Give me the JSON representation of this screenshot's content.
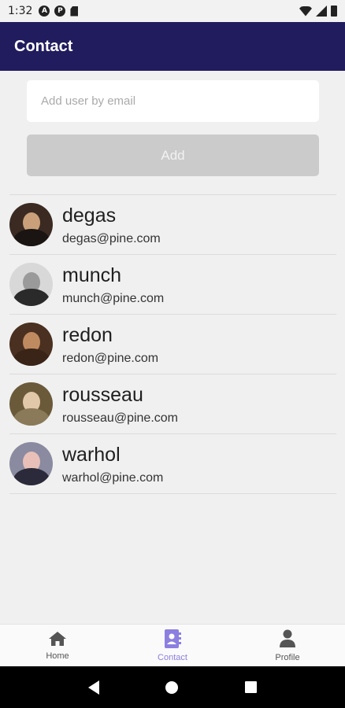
{
  "status_bar": {
    "time": "1:32"
  },
  "app_bar": {
    "title": "Contact"
  },
  "add_form": {
    "email_placeholder": "Add user by email",
    "add_label": "Add"
  },
  "contacts": [
    {
      "name": "degas",
      "email": "degas@pine.com",
      "avatar_colors": {
        "bg": "#3a2a22",
        "face": "#c9a07a",
        "body": "#1a1412"
      }
    },
    {
      "name": "munch",
      "email": "munch@pine.com",
      "avatar_colors": {
        "bg": "#d8d8d8",
        "face": "#9a9a9a",
        "body": "#2a2a2a"
      }
    },
    {
      "name": "redon",
      "email": "redon@pine.com",
      "avatar_colors": {
        "bg": "#4a3020",
        "face": "#c08a60",
        "body": "#3a2418"
      }
    },
    {
      "name": "rousseau",
      "email": "rousseau@pine.com",
      "avatar_colors": {
        "bg": "#6a5a3a",
        "face": "#e0c8a8",
        "body": "#8a7a5a"
      }
    },
    {
      "name": "warhol",
      "email": "warhol@pine.com",
      "avatar_colors": {
        "bg": "#8a8aa0",
        "face": "#e8c0b8",
        "body": "#2a2a3a"
      }
    }
  ],
  "bottom_nav": [
    {
      "label": "Home",
      "icon": "home-icon",
      "active": false
    },
    {
      "label": "Contact",
      "icon": "contact-book-icon",
      "active": true
    },
    {
      "label": "Profile",
      "icon": "person-icon",
      "active": false
    }
  ],
  "colors": {
    "app_bar": "#211c5e",
    "accent": "#8b7fe0",
    "nav_icon": "#555555"
  }
}
